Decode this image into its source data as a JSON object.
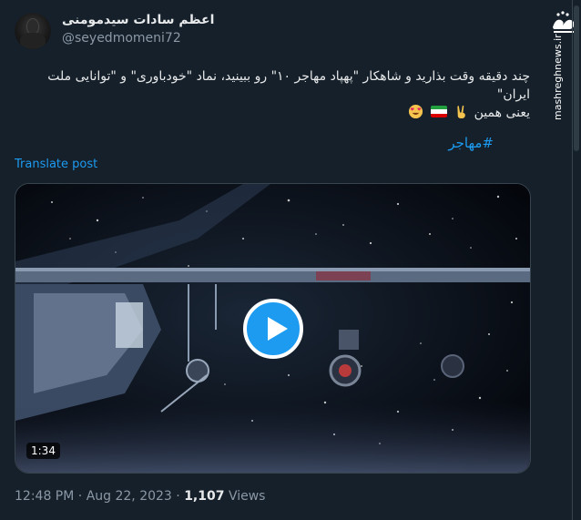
{
  "user": {
    "display_name": "اعظم سادات سیدمومنی",
    "handle": "@seyedmomeni72"
  },
  "tweet": {
    "line1": "چند دقیقه وقت بذارید و شاهکار \"پهپاد مهاجر ۱۰\"  رو ببینید، نماد \"خودباوری\" و \"توانایی ملت ایران\"",
    "line2": "یعنی همین",
    "hashtag": "#مهاجر",
    "translate_label": "Translate post"
  },
  "video": {
    "duration": "1:34"
  },
  "meta": {
    "time": "12:48 PM",
    "separator": " · ",
    "date": "Aug 22, 2023",
    "views_count": "1,107",
    "views_label": "Views"
  },
  "watermark": {
    "logo_text": "مشرق",
    "url": "mashreghnews.ir"
  },
  "icons": [
    "victory-hand-icon",
    "iran-flag-icon",
    "heart-eyes-emoji-icon",
    "play-icon"
  ],
  "colors": {
    "background": "#15202b",
    "accent": "#1d9bf0",
    "text": "#e7e9ea",
    "muted": "#8b98a5"
  }
}
